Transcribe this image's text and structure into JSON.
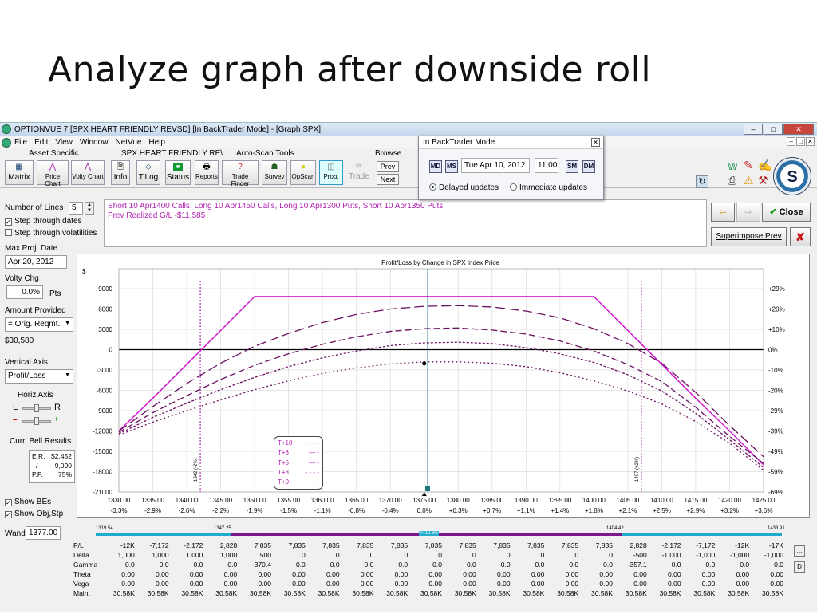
{
  "slide": {
    "title": "Analyze graph after downside roll"
  },
  "window": {
    "title": "OPTIONVUE 7   [SPX HEART FRIENDLY REVSD]  [In BackTrader Mode] - [Graph SPX]",
    "min": "–",
    "max": "□",
    "close": "✕"
  },
  "menu": [
    "File",
    "Edit",
    "View",
    "Window",
    "NetVue",
    "Help"
  ],
  "toolbar": {
    "group_asset": "Asset Specific",
    "group_portfolio": "SPX HEART FRIENDLY RE\\",
    "group_autoscan": "Auto-Scan Tools",
    "group_browse": "Browse",
    "buttons": [
      "Matrix",
      "Price Chart",
      "Volty Chart",
      "Info",
      "T.Log",
      "Status",
      "Reports",
      "Trade Finder",
      "Survey",
      "OpScan",
      "Prob.",
      "Trade"
    ],
    "prev": "Prev",
    "next": "Next"
  },
  "backtrader": {
    "title": "In BackTrader Mode",
    "date": "Tue Apr 10, 2012",
    "time": "11:00",
    "nav": [
      "MD",
      "MS",
      "SM",
      "DM"
    ],
    "delayed": "Delayed updates",
    "immediate": "Immediate updates"
  },
  "left": {
    "num_lines_label": "Number of Lines",
    "num_lines": "5",
    "step_dates": "Step through dates",
    "step_vols": "Step through volatilities",
    "max_proj_label": "Max Proj. Date",
    "max_proj": "Apr 20, 2012",
    "volty_label": "Volty Chg",
    "volty": "0.0%",
    "volty_unit": "Pts",
    "amount_label": "Amount Provided",
    "amount_sel": "= Orig. Reqmt.",
    "amount": "$30,580",
    "vaxis_label": "Vertical Axis",
    "vaxis_sel": "Profit/Loss",
    "haxis_label": "Horiz Axis",
    "haxis_l": "L",
    "haxis_r": "R",
    "minus": "–",
    "plus": "+",
    "bell_label": "Curr. Bell Results",
    "bell": [
      [
        "E.R.",
        "$2,452"
      ],
      [
        "+/-",
        "9,090"
      ],
      [
        "P.P.",
        "75%"
      ]
    ],
    "show_bes": "Show BEs",
    "show_obj": "Show Obj,Stp",
    "wand_label": "Wand",
    "wand": "1377.00"
  },
  "trade": {
    "line1": "Short 10 Apr1400 Calls, Long 10 Apr1450 Calls, Long 10 Apr1300 Puts, Short 10 Apr1350 Puts",
    "line2": "Prev Realized G/L -$11,585"
  },
  "right": {
    "close": "Close",
    "superimpose": "Superimpose Prev"
  },
  "chart_data": {
    "type": "line",
    "title": "Profit/Loss by Change in SPX Index Price",
    "ylabel": "$",
    "x": [
      1330,
      1335,
      1340,
      1345,
      1350,
      1355,
      1360,
      1365,
      1370,
      1375,
      1380,
      1385,
      1390,
      1395,
      1400,
      1405,
      1410,
      1415,
      1420,
      1425
    ],
    "xticks": [
      "1330.00",
      "1335.00",
      "1340.00",
      "1345.00",
      "1350.00",
      "1355.00",
      "1360.00",
      "1365.00",
      "1370.00",
      "1375.00",
      "1380.00",
      "1385.00",
      "1390.00",
      "1395.00",
      "1400.00",
      "1405.00",
      "1410.00",
      "1415.00",
      "1420.00",
      "1425.00"
    ],
    "xpct": [
      "-3.3%",
      "-2.9%",
      "-2.6%",
      "-2.2%",
      "-1.9%",
      "-1.5%",
      "-1.1%",
      "-0.8%",
      "-0.4%",
      "0.0%",
      "+0.3%",
      "+0.7%",
      "+1.1%",
      "+1.4%",
      "+1.8%",
      "+2.1%",
      "+2.5%",
      "+2.9%",
      "+3.2%",
      "+3.6%"
    ],
    "yticks": [
      9000,
      6000,
      3000,
      0,
      -3000,
      -6000,
      -9000,
      -12000,
      -15000,
      -18000,
      -21000
    ],
    "ylim": [
      -21000,
      10500
    ],
    "ypct": [
      "+29%",
      "+20%",
      "+10%",
      "0%",
      "-10%",
      "-20%",
      "-29%",
      "-39%",
      "-49%",
      "-59%",
      "-69%"
    ],
    "series": [
      {
        "name": "T+10",
        "color": "#d020d0",
        "dash": "",
        "values": [
          -12000,
          -7172,
          -2172,
          2828,
          7835,
          7835,
          7835,
          7835,
          7835,
          7835,
          7835,
          7835,
          7835,
          7835,
          7835,
          2828,
          -2172,
          -7172,
          -12000,
          -17000
        ]
      },
      {
        "name": "T+8",
        "color": "#6a1060",
        "dash": "12 5",
        "values": [
          -12000,
          -8400,
          -5000,
          -2000,
          500,
          2400,
          4000,
          5200,
          6000,
          6400,
          6500,
          6300,
          5700,
          4700,
          3100,
          900,
          -2000,
          -6300,
          -11200,
          -15800
        ]
      },
      {
        "name": "T+5",
        "color": "#6a1060",
        "dash": "8 4",
        "values": [
          -12200,
          -9300,
          -6800,
          -4400,
          -2300,
          -600,
          800,
          1900,
          2700,
          3100,
          3200,
          2900,
          2300,
          1300,
          -200,
          -2200,
          -4700,
          -8500,
          -12800,
          -16800
        ]
      },
      {
        "name": "T+3",
        "color": "#6a1060",
        "dash": "3 2",
        "values": [
          -12400,
          -10000,
          -7900,
          -5900,
          -4100,
          -2500,
          -1200,
          -200,
          600,
          1000,
          1100,
          900,
          300,
          -600,
          -1900,
          -3700,
          -6100,
          -9400,
          -13300,
          -17400
        ]
      },
      {
        "name": "T+0",
        "color": "#6a1060",
        "dash": "2 3",
        "values": [
          -12600,
          -10700,
          -9000,
          -7400,
          -5900,
          -4600,
          -3500,
          -2700,
          -2100,
          -1800,
          -1800,
          -2000,
          -2500,
          -3400,
          -4600,
          -6100,
          -8000,
          -10600,
          -13800,
          -17800
        ]
      }
    ],
    "be_lines": [
      {
        "label": "1342 (-2%)",
        "x": 1342
      },
      {
        "label": "1407 (+2%)",
        "x": 1407
      }
    ],
    "current": 1375.5,
    "bottom_labels": {
      "left": "1319.54",
      "l2": "1347.25",
      "mid": "V=12.6%",
      "r2": "1404.42",
      "right": "1433.91"
    }
  },
  "grid": {
    "rows": [
      {
        "label": "P/L",
        "vals": [
          "-12K",
          "-7,172",
          "-2,172",
          "2,828",
          "7,835",
          "7,835",
          "7,835",
          "7,835",
          "7,835",
          "7,835",
          "7,835",
          "7,835",
          "7,835",
          "7,835",
          "7,835",
          "2,828",
          "-2,172",
          "-7,172",
          "-12K",
          "-17K"
        ]
      },
      {
        "label": "Delta",
        "vals": [
          "1,000",
          "1,000",
          "1,000",
          "1,000",
          "500",
          "0",
          "0",
          "0",
          "0",
          "0",
          "0",
          "0",
          "0",
          "0",
          "0",
          "-500",
          "-1,000",
          "-1,000",
          "-1,000",
          "-1,000"
        ]
      },
      {
        "label": "Gamma",
        "vals": [
          "0.0",
          "0.0",
          "0.0",
          "0.0",
          "-370.4",
          "0.0",
          "0.0",
          "0.0",
          "0.0",
          "0.0",
          "0.0",
          "0.0",
          "0.0",
          "0.0",
          "0.0",
          "-357.1",
          "0.0",
          "0.0",
          "0.0",
          "0.0"
        ]
      },
      {
        "label": "Theta",
        "vals": [
          "0.00",
          "0.00",
          "0.00",
          "0.00",
          "0.00",
          "0.00",
          "0.00",
          "0.00",
          "0.00",
          "0.00",
          "0.00",
          "0.00",
          "0.00",
          "0.00",
          "0.00",
          "0.00",
          "0.00",
          "0.00",
          "0.00",
          "0.00"
        ]
      },
      {
        "label": "Vega",
        "vals": [
          "0.00",
          "0.00",
          "0.00",
          "0.00",
          "0.00",
          "0.00",
          "0.00",
          "0.00",
          "0.00",
          "0.00",
          "0.00",
          "0.00",
          "0.00",
          "0.00",
          "0.00",
          "0.00",
          "0.00",
          "0.00",
          "0.00",
          "0.00"
        ]
      },
      {
        "label": "Maint",
        "vals": [
          "30.58K",
          "30.58K",
          "30.58K",
          "30.58K",
          "30.58K",
          "30.58K",
          "30.58K",
          "30.58K",
          "30.58K",
          "30.58K",
          "30.58K",
          "30.58K",
          "30.58K",
          "30.58K",
          "30.58K",
          "30.58K",
          "30.58K",
          "30.58K",
          "30.58K",
          "30.58K"
        ]
      }
    ],
    "side_btn1": "...",
    "side_btn2": "D"
  }
}
